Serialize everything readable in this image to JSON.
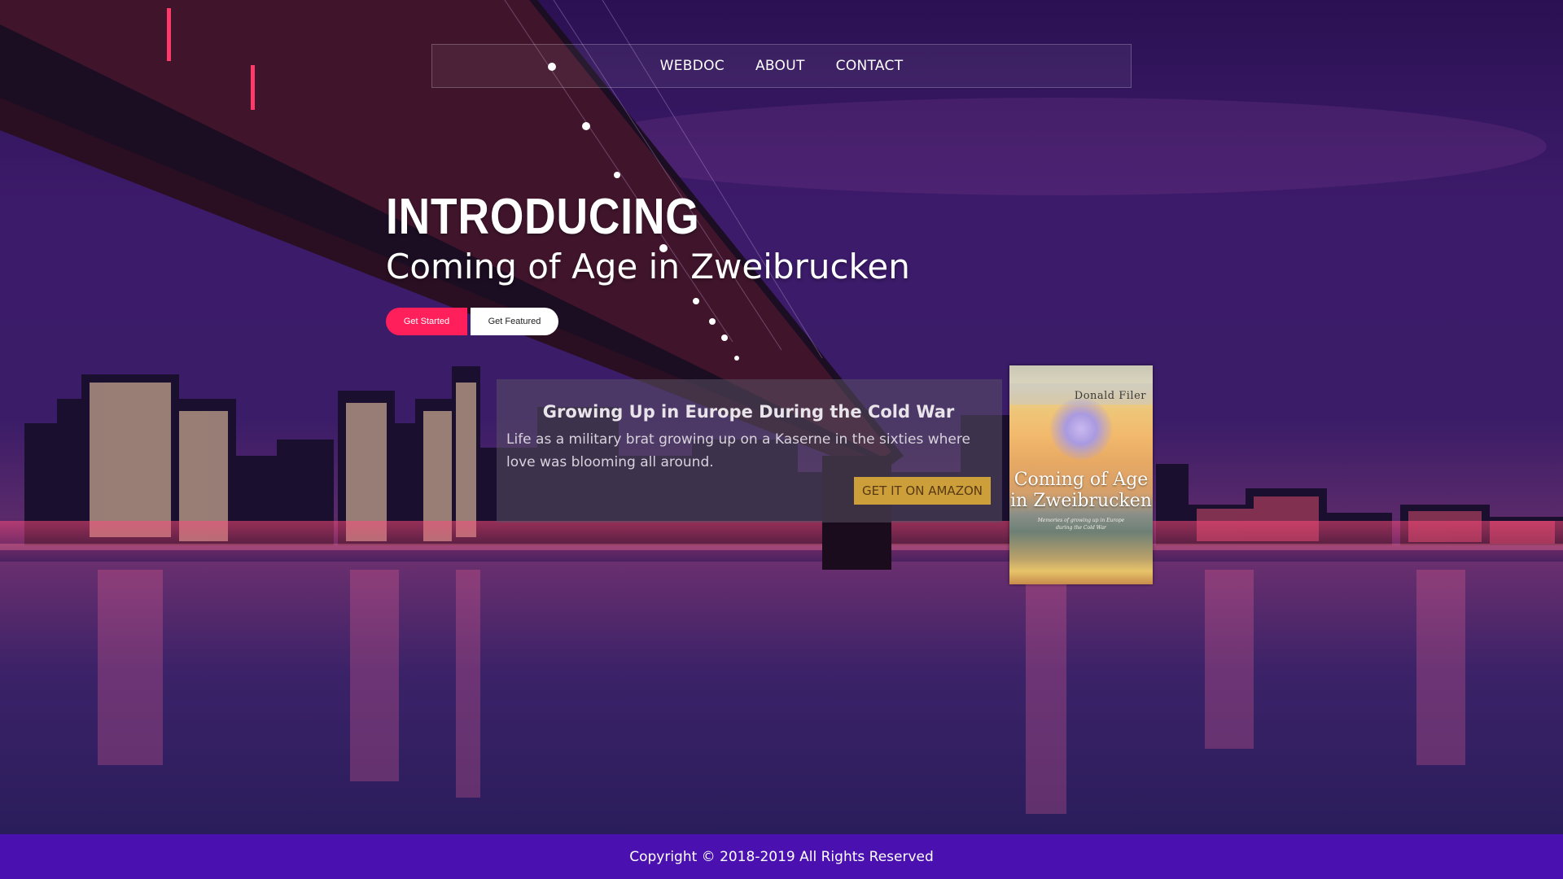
{
  "nav": {
    "items": [
      {
        "label": "WEBDOC"
      },
      {
        "label": "ABOUT"
      },
      {
        "label": "CONTACT"
      }
    ]
  },
  "hero": {
    "kicker": "INTRODUCING",
    "title": "Coming of Age in Zweibrucken",
    "primary_button": "Get Started",
    "secondary_button": "Get Featured"
  },
  "card": {
    "heading": "Growing Up in Europe During the Cold War",
    "text": "Life as a military brat growing up on a Kaserne in the sixties where love was blooming all around.",
    "cta": "GET IT ON AMAZON"
  },
  "book": {
    "author": "Donald Filer",
    "title_line1": "Coming of Age",
    "title_line2": "in Zweibrucken",
    "subtitle_line1": "Memories of growing up in Europe",
    "subtitle_line2": "during the Cold War"
  },
  "footer": {
    "copyright": "Copyright © 2018-2019 All Rights Reserved"
  },
  "colors": {
    "primary_button": "#ff1f5a",
    "footer_bg": "#4a10b0",
    "amazon_button": "#d9a93a"
  }
}
